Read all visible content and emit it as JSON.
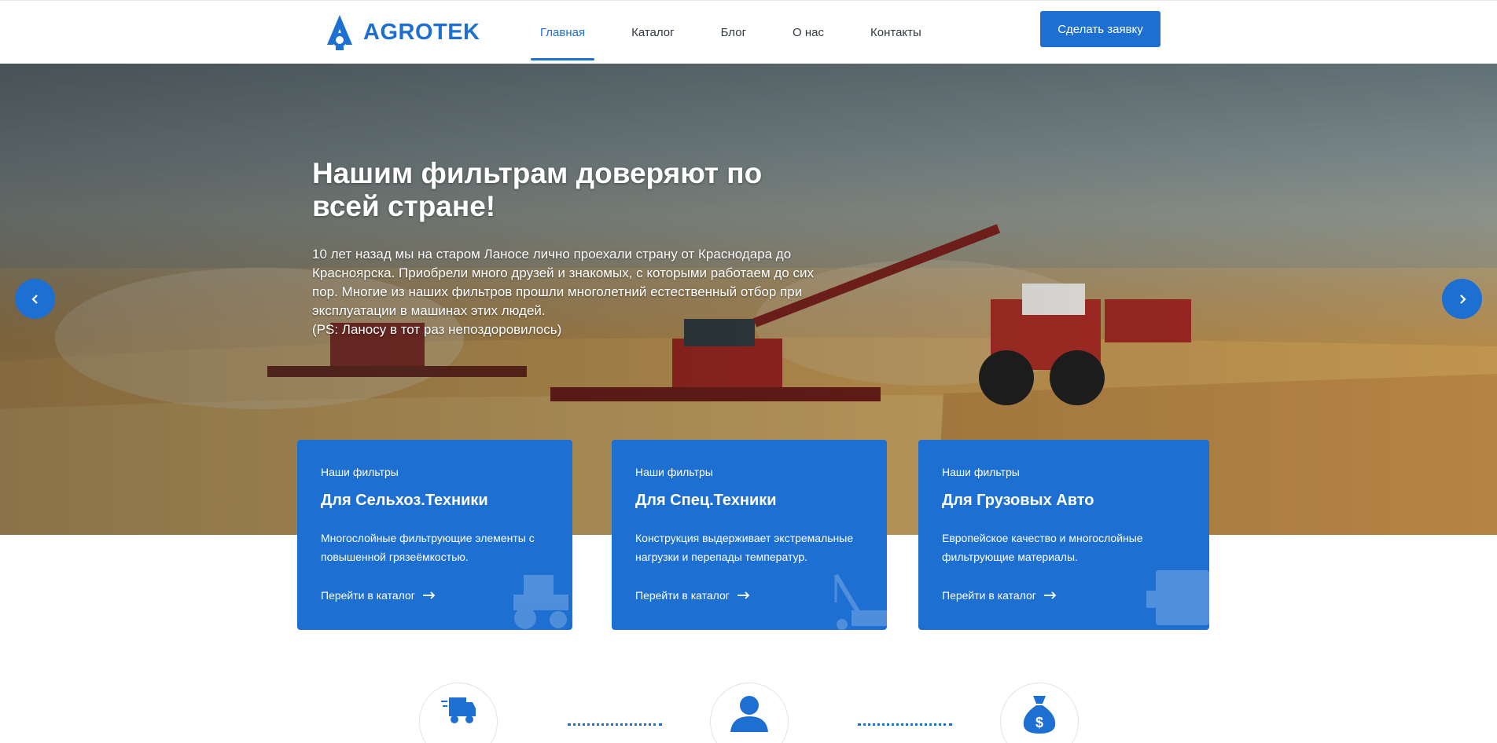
{
  "header": {
    "logo_text": "AGROTEK",
    "nav": [
      "Главная",
      "Каталог",
      "Блог",
      "О нас",
      "Контакты"
    ],
    "active_nav": "Главная",
    "cta_label": "Сделать заявку"
  },
  "hero": {
    "title": "Нашим фильтрам доверяют по всей стране!",
    "text_line1": "10 лет назад мы на старом Ланосе лично проехали страну от Краснодара до Красноярска. Приобрели много друзей и знакомых, с которыми работаем до сих пор. Многие из наших фильтров прошли многолетний естественный отбор при эксплуатации в машинах этих людей.",
    "text_line2": "(PS: Ланосу в тот раз непоздоровилось)"
  },
  "cards": [
    {
      "kicker": "Наши фильтры",
      "title": "Для Сельхоз.Техники",
      "description": "Многослойные фильтрующие элементы с повышенной грязеёмкостью.",
      "link": "Перейти в каталог",
      "icon": "tractor-icon"
    },
    {
      "kicker": "Наши фильтры",
      "title": "Для Спец.Техники",
      "description": "Конструкция выдерживает экстремальные нагрузки и перепады температур.",
      "link": "Перейти в каталог",
      "icon": "crane-icon"
    },
    {
      "kicker": "Наши фильтры",
      "title": "Для Грузовых Авто",
      "description": "Европейское качество и многослойные фильтрующие материалы.",
      "link": "Перейти в каталог",
      "icon": "truck-icon"
    }
  ],
  "process_icons": [
    "delivery-truck-icon",
    "person-icon",
    "money-bag-icon"
  ],
  "colors": {
    "accent": "#1d6fd1",
    "text_dark": "#333a44"
  }
}
